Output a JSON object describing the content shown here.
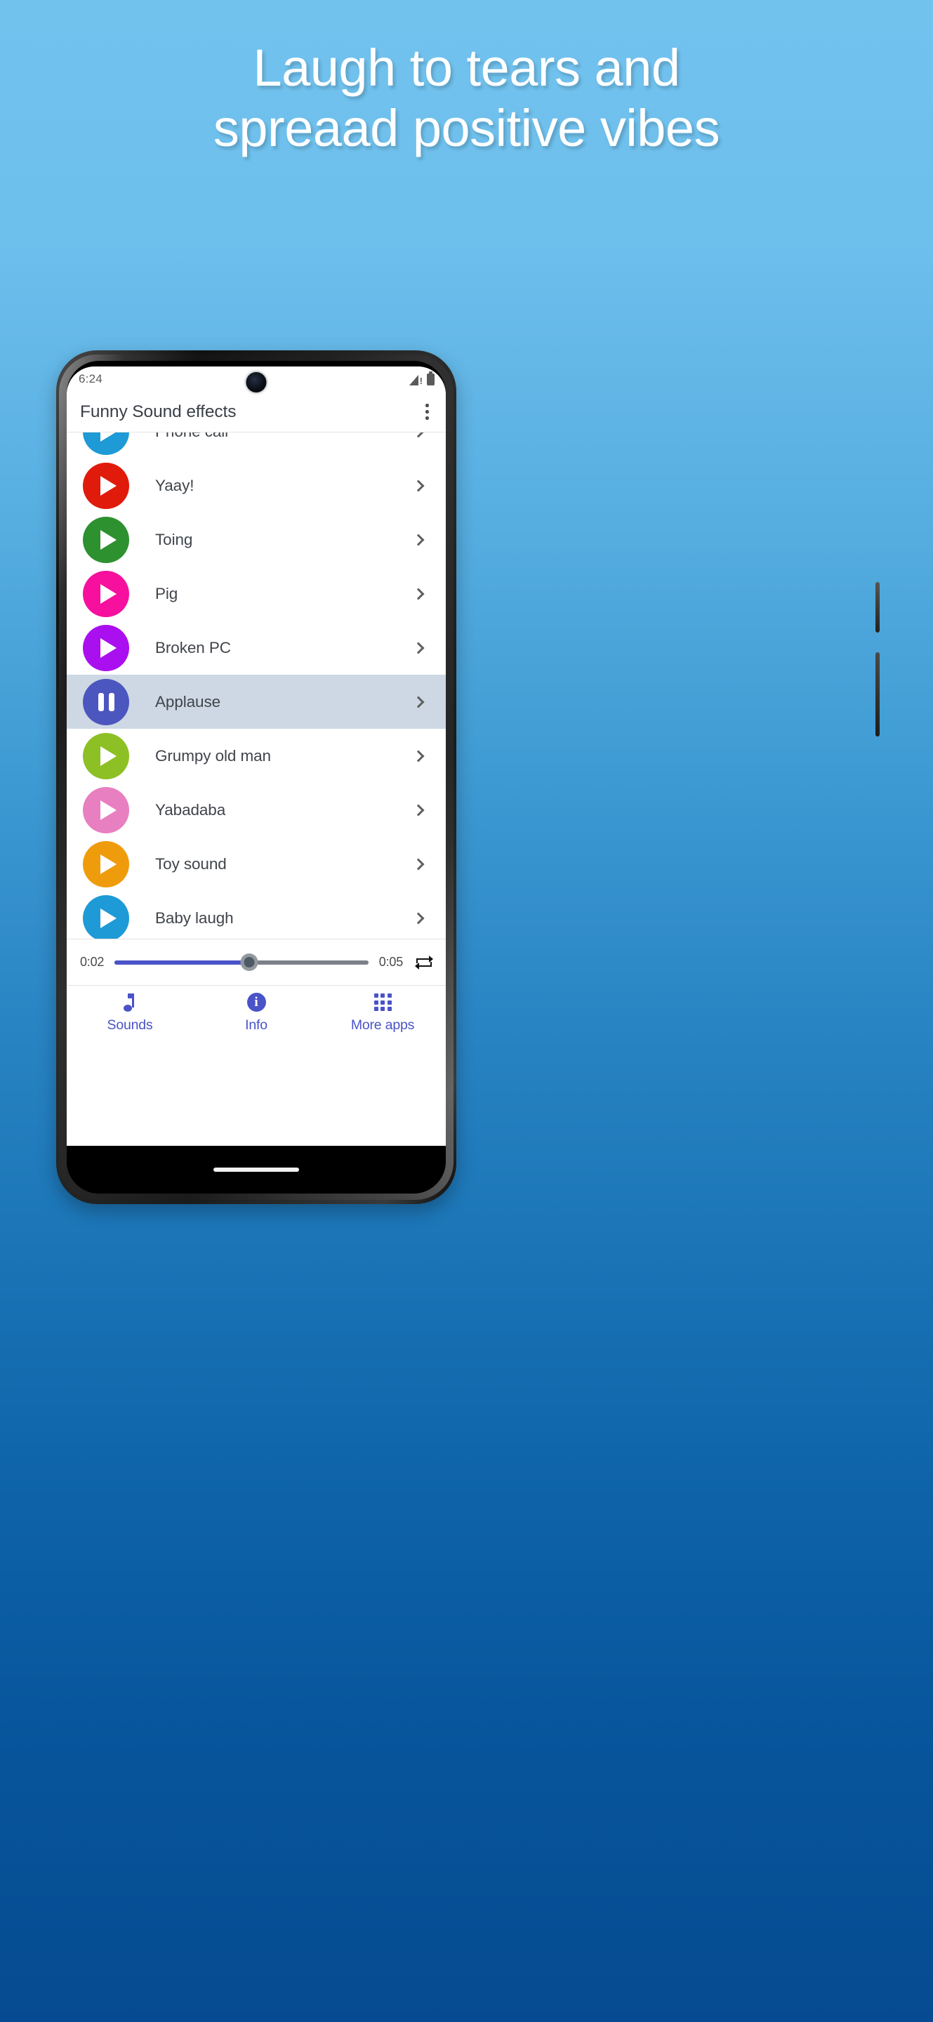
{
  "headline": {
    "line1": "Laugh to tears and",
    "line2": "spreaad positive vibes"
  },
  "phone": {
    "status_bar": {
      "time": "6:24",
      "signal_icon": "signal-bars-alert-icon",
      "battery_icon": "battery-full-icon",
      "camera_icon": "front-camera-punch-hole"
    },
    "app_bar": {
      "title": "Funny Sound effects",
      "overflow_icon": "kebab-menu-icon"
    },
    "sound_list": [
      {
        "label": "Phone call",
        "color": "#1e9ad6",
        "state": "play",
        "icon": "play-icon",
        "chevron": "chevron-right-icon"
      },
      {
        "label": "Yaay!",
        "color": "#e01b0c",
        "state": "play",
        "icon": "play-icon",
        "chevron": "chevron-right-icon"
      },
      {
        "label": "Toing",
        "color": "#2e9130",
        "state": "play",
        "icon": "play-icon",
        "chevron": "chevron-right-icon"
      },
      {
        "label": "Pig",
        "color": "#f6109d",
        "state": "play",
        "icon": "play-icon",
        "chevron": "chevron-right-icon"
      },
      {
        "label": "Broken PC",
        "color": "#aa0ff0",
        "state": "play",
        "icon": "play-icon",
        "chevron": "chevron-right-icon"
      },
      {
        "label": "Applause",
        "color": "#4c56bf",
        "state": "pause",
        "icon": "pause-icon",
        "chevron": "chevron-right-icon",
        "selected": true
      },
      {
        "label": "Grumpy old man",
        "color": "#8dc024",
        "state": "play",
        "icon": "play-icon",
        "chevron": "chevron-right-icon"
      },
      {
        "label": "Yabadaba",
        "color": "#e87fc0",
        "state": "play",
        "icon": "play-icon",
        "chevron": "chevron-right-icon"
      },
      {
        "label": "Toy sound",
        "color": "#ef9c0c",
        "state": "play",
        "icon": "play-icon",
        "chevron": "chevron-right-icon"
      },
      {
        "label": "Baby laugh",
        "color": "#1e9ad6",
        "state": "play",
        "icon": "play-icon",
        "chevron": "chevron-right-icon"
      }
    ],
    "player": {
      "current_time": "0:02",
      "total_time": "0:05",
      "progress_percent": 53,
      "loop_icon": "repeat-loop-icon"
    },
    "bottom_nav": [
      {
        "label": "Sounds",
        "icon": "music-note-icon"
      },
      {
        "label": "Info",
        "icon": "info-circle-icon"
      },
      {
        "label": "More apps",
        "icon": "grid-apps-icon"
      }
    ]
  },
  "colors": {
    "accent": "#4a53c8",
    "selected_row_bg": "#cdd8e4",
    "bg_top": "#72c2ee",
    "bg_bottom": "#064b91"
  }
}
